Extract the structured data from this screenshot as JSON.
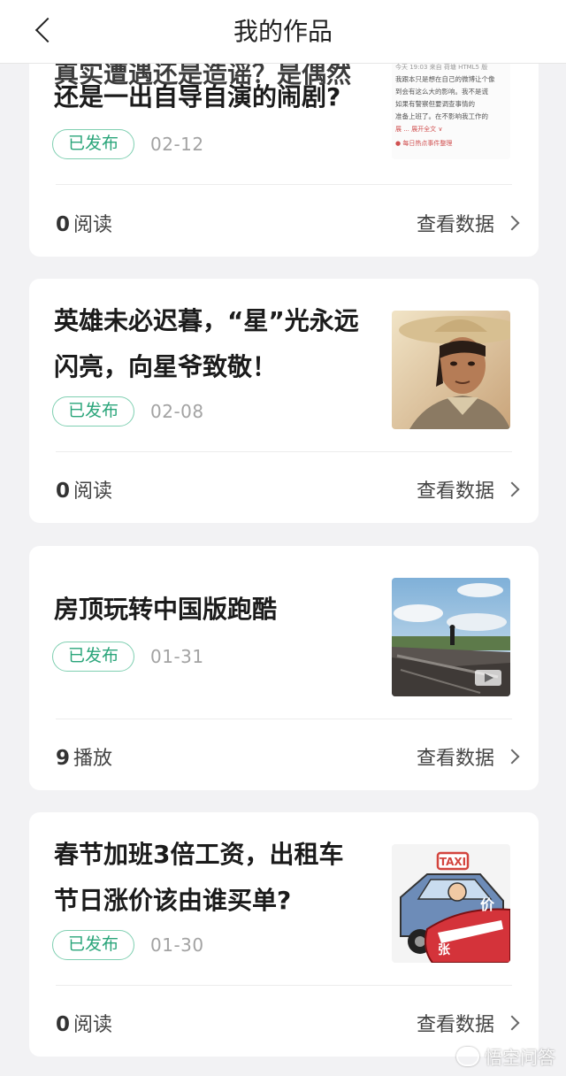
{
  "header": {
    "title": "我的作品"
  },
  "view_data_label": "查看数据",
  "articles": [
    {
      "title_lines": [
        "还是一出自导自演的闹剧?"
      ],
      "status": "已发布",
      "date": "02-12",
      "count": "0",
      "count_unit": "阅读",
      "thumbnail": "text-screenshot-thumbnail"
    },
    {
      "title_lines": [
        "英雄未必迟暮，“星”光永远",
        "闪亮，向星爷致敬！"
      ],
      "status": "已发布",
      "date": "02-08",
      "count": "0",
      "count_unit": "阅读",
      "thumbnail": "man-in-straw-hat-thumbnail"
    },
    {
      "title_lines": [
        "房顶玩转中国版跑酷"
      ],
      "status": "已发布",
      "date": "01-31",
      "count": "9",
      "count_unit": "播放",
      "thumbnail": "rooftop-video-thumbnail"
    },
    {
      "title_lines": [
        "春节加班3倍工资，出租车",
        "节日涨价该由谁买单?"
      ],
      "status": "已发布",
      "date": "01-30",
      "count": "0",
      "count_unit": "阅读",
      "thumbnail": "taxi-cartoon-thumbnail"
    }
  ],
  "thumb_text": {
    "screenshot_lines": [
      "今天 19:03 来自 荷塘 HTML5 版",
      "我跟本只是想在自己的微博让个像",
      "到会有这么大的影响。我不是谎",
      "如果有警察但要调查事情的",
      "准备上班了。在不影响我工作的",
      "展 ... 展开全文 ∨",
      "● 每日热点事件整理"
    ],
    "taxi_sign": "TAXI",
    "price_label": "价",
    "rise_label": "张"
  },
  "watermark": {
    "text": "悟空问答"
  }
}
